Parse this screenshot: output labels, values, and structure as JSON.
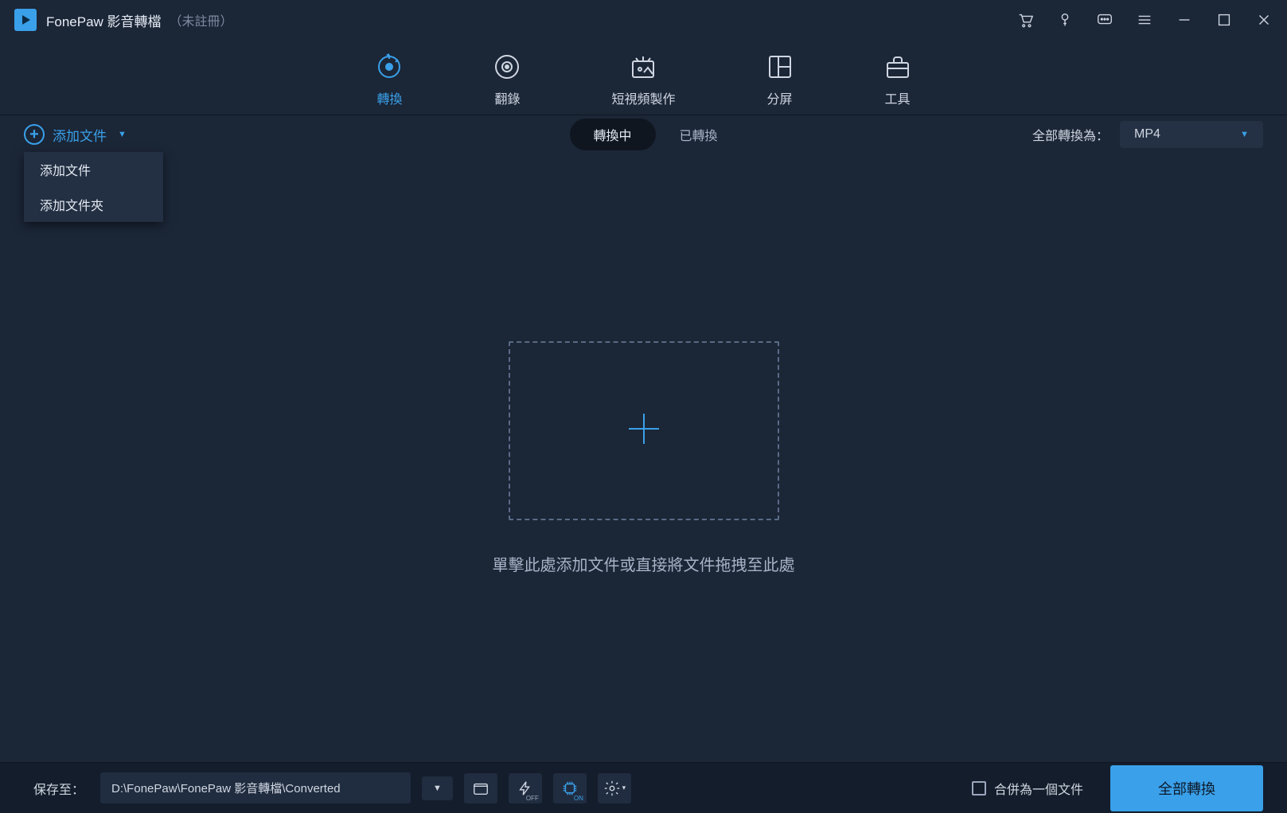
{
  "titlebar": {
    "app_name": "FonePaw 影音轉檔",
    "status": "（未註冊）"
  },
  "nav": {
    "tabs": [
      {
        "label": "轉換",
        "icon": "convert",
        "active": true
      },
      {
        "label": "翻錄",
        "icon": "rip",
        "active": false
      },
      {
        "label": "短視頻製作",
        "icon": "mv",
        "active": false
      },
      {
        "label": "分屏",
        "icon": "collage",
        "active": false
      },
      {
        "label": "工具",
        "icon": "toolbox",
        "active": false
      }
    ]
  },
  "toolbar": {
    "add_file_label": "添加文件",
    "dropdown": [
      "添加文件",
      "添加文件夾"
    ],
    "segment": {
      "converting": "轉換中",
      "converted": "已轉換"
    },
    "format_label": "全部轉換為：",
    "format_value": "MP4"
  },
  "main": {
    "drop_hint": "單擊此處添加文件或直接將文件拖拽至此處"
  },
  "bottombar": {
    "save_to_label": "保存至：",
    "save_path": "D:\\FonePaw\\FonePaw 影音轉檔\\Converted",
    "merge_label": "合併為一個文件",
    "convert_all": "全部轉換"
  }
}
